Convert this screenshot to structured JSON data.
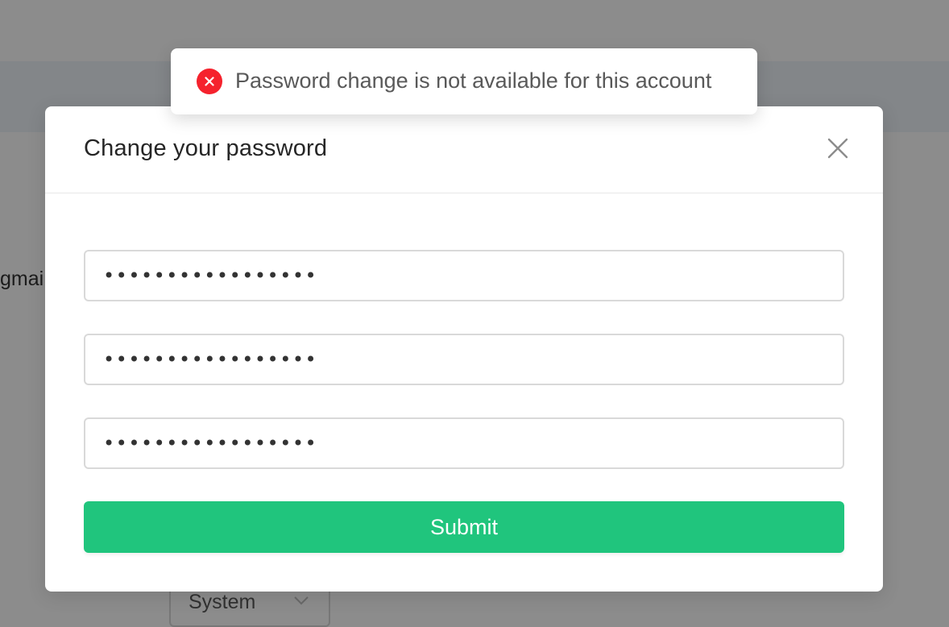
{
  "background": {
    "email_fragment": "gmai",
    "language_select": {
      "value": "System"
    }
  },
  "toast": {
    "message": "Password change is not available for this account",
    "type": "error",
    "icon": "error-circle-icon",
    "color": "#f5222d"
  },
  "modal": {
    "title": "Change your password",
    "close_icon": "close-icon",
    "fields": [
      {
        "value": "xxxxxxxxxxxxxxxxx"
      },
      {
        "value": "xxxxxxxxxxxxxxxxx"
      },
      {
        "value": "xxxxxxxxxxxxxxxxx"
      }
    ],
    "submit_label": "Submit",
    "submit_color": "#20c57d"
  }
}
